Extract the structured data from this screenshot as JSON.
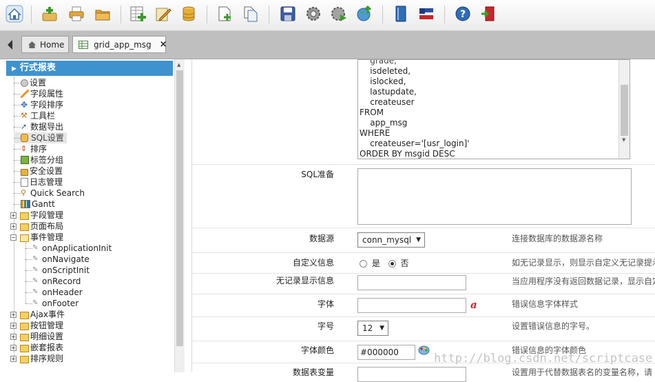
{
  "toolbar": {
    "icons": [
      "home-icon",
      "add-icon",
      "print-icon",
      "folder-icon",
      "add-grid-icon",
      "edit-icon",
      "database-icon",
      "new-document-icon",
      "copy-document-icon",
      "save-icon",
      "settings-icon",
      "run-icon",
      "publish-icon",
      "book-icon",
      "language-icon",
      "help-icon",
      "exit-icon"
    ]
  },
  "tabs": {
    "home_label": "Home",
    "active_label": "grid_app_msg",
    "close_glyph": "×"
  },
  "sidebar": {
    "header": "行式报表",
    "items": [
      {
        "label": "设置"
      },
      {
        "label": "字段属性"
      },
      {
        "label": "字段排序"
      },
      {
        "label": "工具栏"
      },
      {
        "label": "数据导出"
      },
      {
        "label": "SQL设置"
      },
      {
        "label": "排序"
      },
      {
        "label": "标签分组"
      },
      {
        "label": "安全设置"
      },
      {
        "label": "日志管理"
      },
      {
        "label": "Quick Search"
      },
      {
        "label": "Gantt"
      },
      {
        "label": "字段管理"
      },
      {
        "label": "页面布局"
      },
      {
        "label": "事件管理"
      },
      {
        "label": "onApplicationInit"
      },
      {
        "label": "onNavigate"
      },
      {
        "label": "onScriptInit"
      },
      {
        "label": "onRecord"
      },
      {
        "label": "onHeader"
      },
      {
        "label": "onFooter"
      },
      {
        "label": "Ajax事件"
      },
      {
        "label": "按钮管理"
      },
      {
        "label": "明细设置"
      },
      {
        "label": "嵌套报表"
      },
      {
        "label": "排序规则"
      }
    ]
  },
  "form": {
    "sql_lines": [
      "    grade,",
      "    isdeleted,",
      "    islocked,",
      "    lastupdate,",
      "    createuser",
      "FROM",
      "    app_msg",
      "WHERE",
      "    createuser='[usr_login]'",
      "ORDER BY msgid DESC"
    ],
    "sql_prepare_label": "SQL准备",
    "datasource_label": "数据源",
    "datasource_value": "conn_mysql",
    "datasource_desc": "连接数据库的数据源名称",
    "custom_info_label": "自定义信息",
    "custom_info_yes": "是",
    "custom_info_no": "否",
    "custom_info_desc": "如无记录显示，则显示自定义无记录提示",
    "no_record_label": "无记录显示信息",
    "no_record_desc": "当应用程序没有返回数据记录，显示自定",
    "font_label": "字体",
    "font_desc": "错误信息字体样式",
    "font_size_label": "字号",
    "font_size_value": "12",
    "font_size_desc": "设置错误信息的字号。",
    "font_color_label": "字体颜色",
    "font_color_value": "#000000",
    "font_color_desc": "错误信息的字体颜色",
    "table_var_label": "数据表变量",
    "table_var_desc": "设置用于代替数据表名的变量名称，请"
  },
  "watermark": "http://blog.csdn.net/scriptcase"
}
